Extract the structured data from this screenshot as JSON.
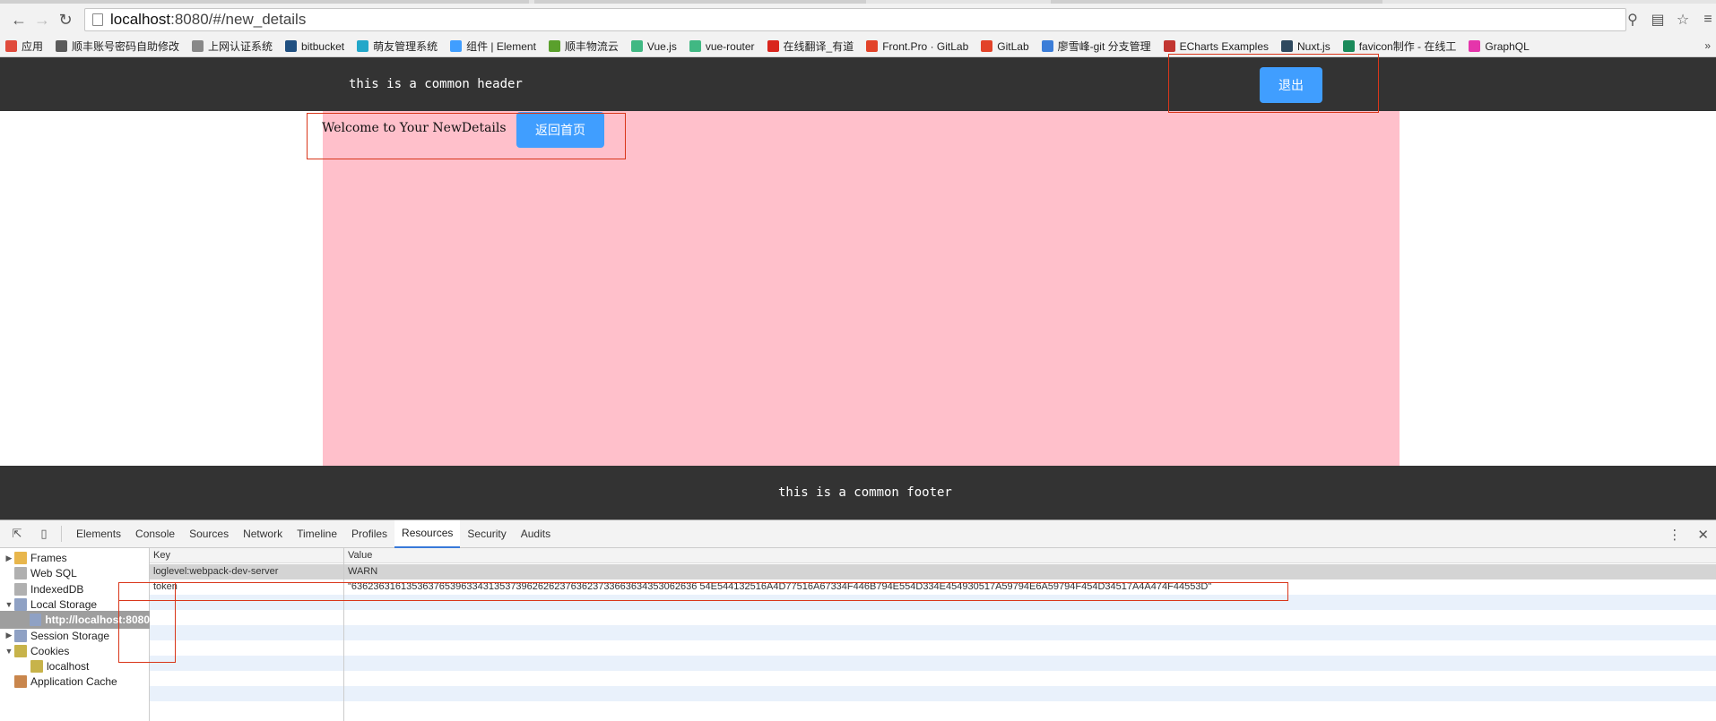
{
  "browser": {
    "url_host": "localhost",
    "url_rest": ":8080/#/new_details",
    "bookmarks": [
      {
        "label": "应用",
        "color": "#e04b3c"
      },
      {
        "label": "顺丰账号密码自助修改",
        "color": "#5a5a5a"
      },
      {
        "label": "上网认证系统",
        "color": "#888888"
      },
      {
        "label": "bitbucket",
        "color": "#205081"
      },
      {
        "label": "萌友管理系统",
        "color": "#22a7c9"
      },
      {
        "label": "组件 | Element",
        "color": "#409eff"
      },
      {
        "label": "顺丰物流云",
        "color": "#5aa02c"
      },
      {
        "label": "Vue.js",
        "color": "#41b883"
      },
      {
        "label": "vue-router",
        "color": "#41b883"
      },
      {
        "label": "在线翻译_有道",
        "color": "#d9251d"
      },
      {
        "label": "Front.Pro · GitLab",
        "color": "#e24329"
      },
      {
        "label": "GitLab",
        "color": "#e24329"
      },
      {
        "label": "廖雪峰-git 分支管理",
        "color": "#3b7dd8"
      },
      {
        "label": "ECharts Examples",
        "color": "#c23531"
      },
      {
        "label": "Nuxt.js",
        "color": "#2f495e"
      },
      {
        "label": "favicon制作 - 在线工",
        "color": "#1a8a5a"
      },
      {
        "label": "GraphQL",
        "color": "#e535ab"
      }
    ],
    "more_label": "»"
  },
  "page": {
    "header_text": "this is a common header",
    "logout_label": "退出",
    "welcome_text": "Welcome to Your NewDetails",
    "home_label": "返回首页",
    "footer_text": "this is a common footer"
  },
  "devtools": {
    "tabs": [
      "Elements",
      "Console",
      "Sources",
      "Network",
      "Timeline",
      "Profiles",
      "Resources",
      "Security",
      "Audits"
    ],
    "active_tab": "Resources",
    "sidebar": [
      {
        "label": "Frames",
        "arrow": "▶",
        "icon": "folder"
      },
      {
        "label": "Web SQL",
        "arrow": "",
        "icon": "db"
      },
      {
        "label": "IndexedDB",
        "arrow": "",
        "icon": "db"
      },
      {
        "label": "Local Storage",
        "arrow": "▼",
        "icon": "grid"
      },
      {
        "label": "http://localhost:8080",
        "arrow": "",
        "icon": "grid",
        "selected": true
      },
      {
        "label": "Session Storage",
        "arrow": "▶",
        "icon": "grid"
      },
      {
        "label": "Cookies",
        "arrow": "▼",
        "icon": "cookie"
      },
      {
        "label": "localhost",
        "arrow": "",
        "icon": "cookie"
      },
      {
        "label": "Application Cache",
        "arrow": "",
        "icon": "cache"
      }
    ],
    "grid": {
      "key_header": "Key",
      "value_header": "Value",
      "rows": [
        {
          "key": "loglevel:webpack-dev-server",
          "value": "WARN"
        },
        {
          "key": "token",
          "value": "\"636236316135363765396334313537396262623763623733663634353062636 54E544132516A4D77516A67334F446B794E554D334E454930517A59794E6A59794F454D34517A4A474F44553D\""
        }
      ]
    }
  },
  "colors": {
    "header_bg": "#333333",
    "content_bg": "#ffc0cb",
    "button_primary": "#409eff",
    "annotation": "#d9361a"
  }
}
